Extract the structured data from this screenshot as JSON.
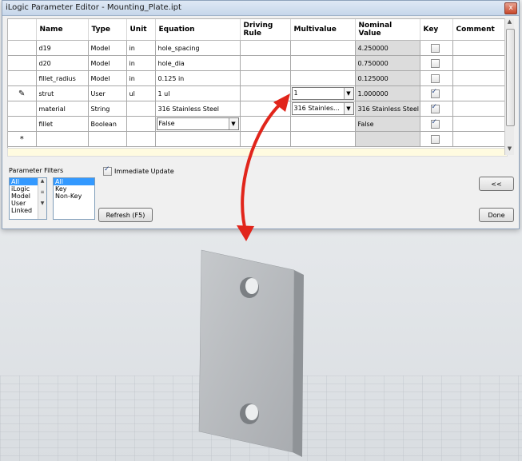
{
  "window": {
    "title": "iLogic Parameter Editor - Mounting_Plate.ipt",
    "close_label": "x"
  },
  "columns": [
    "Name",
    "Type",
    "Unit",
    "Equation",
    "Driving Rule",
    "Multivalue",
    "Nominal Value",
    "Key",
    "Comment"
  ],
  "rows": [
    {
      "marker": "",
      "name": "d19",
      "type": "Model",
      "unit": "in",
      "equation": "hole_spacing",
      "multivalue": "",
      "nominal": "4.250000",
      "key": false
    },
    {
      "marker": "",
      "name": "d20",
      "type": "Model",
      "unit": "in",
      "equation": "hole_dia",
      "multivalue": "",
      "nominal": "0.750000",
      "key": false
    },
    {
      "marker": "",
      "name": "fillet_radius",
      "type": "Model",
      "unit": "in",
      "equation": "0.125 in",
      "multivalue": "",
      "nominal": "0.125000",
      "key": false
    },
    {
      "marker": "✎",
      "name": "strut",
      "type": "User",
      "unit": "ul",
      "equation": "1 ul",
      "multivalue": "1",
      "nominal": "1.000000",
      "key": true
    },
    {
      "marker": "",
      "name": "material",
      "type": "String",
      "unit": "",
      "equation": "316 Stainless Steel",
      "multivalue": "316 Stainles...",
      "nominal": "316 Stainless Steel",
      "key": true
    },
    {
      "marker": "",
      "name": "fillet",
      "type": "Boolean",
      "unit": "",
      "equation": "False",
      "multivalue": "",
      "nominal": "False",
      "key": true
    },
    {
      "marker": "*",
      "name": "",
      "type": "",
      "unit": "",
      "equation": "",
      "multivalue": "",
      "nominal": "",
      "key": false
    }
  ],
  "filters": {
    "label": "Parameter Filters",
    "list1": [
      "All",
      "iLogic",
      "Model",
      "User",
      "Linked"
    ],
    "list1_selected": "All",
    "list2": [
      "All",
      "Key",
      "Non-Key"
    ],
    "list2_selected": "All",
    "immediate_update_label": "Immediate Update",
    "immediate_update_checked": true
  },
  "buttons": {
    "refresh": "Refresh (F5)",
    "collapse": "<<",
    "done": "Done"
  },
  "colors": {
    "arrow": "#e1251b",
    "selection": "#3399ff",
    "plate": "#b5b8bb"
  }
}
